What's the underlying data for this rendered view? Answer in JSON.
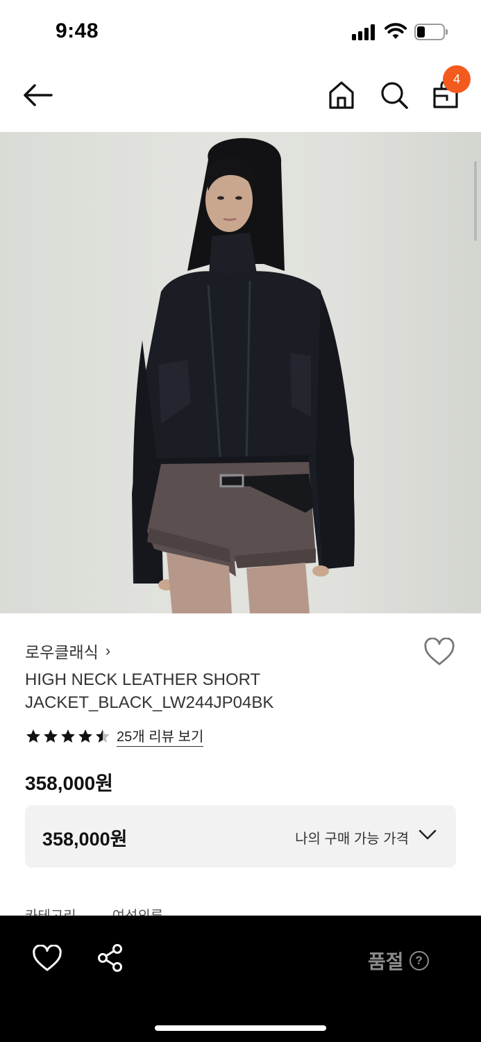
{
  "status_bar": {
    "time": "9:48"
  },
  "header": {
    "back_icon": "arrow-left-icon",
    "home_icon": "home-icon",
    "search_icon": "search-icon",
    "cart_icon": "shopping-bag-icon",
    "cart_count": "4",
    "badge_color": "#f35a1d"
  },
  "product": {
    "image_alt": "model wearing black leather jacket",
    "brand": "로우클래식",
    "title": "HIGH NECK LEATHER SHORT JACKET_BLACK_LW244JP04BK",
    "rating": 4.5,
    "review_link": "25개 리뷰 보기",
    "price": "358,000원"
  },
  "price_box": {
    "amount": "358,000원",
    "label": "나의 구매 가능 가격"
  },
  "cut_off_text": [
    "카테고리",
    "여성의류"
  ],
  "bottom_bar": {
    "status": "품절",
    "help_glyph": "?"
  }
}
